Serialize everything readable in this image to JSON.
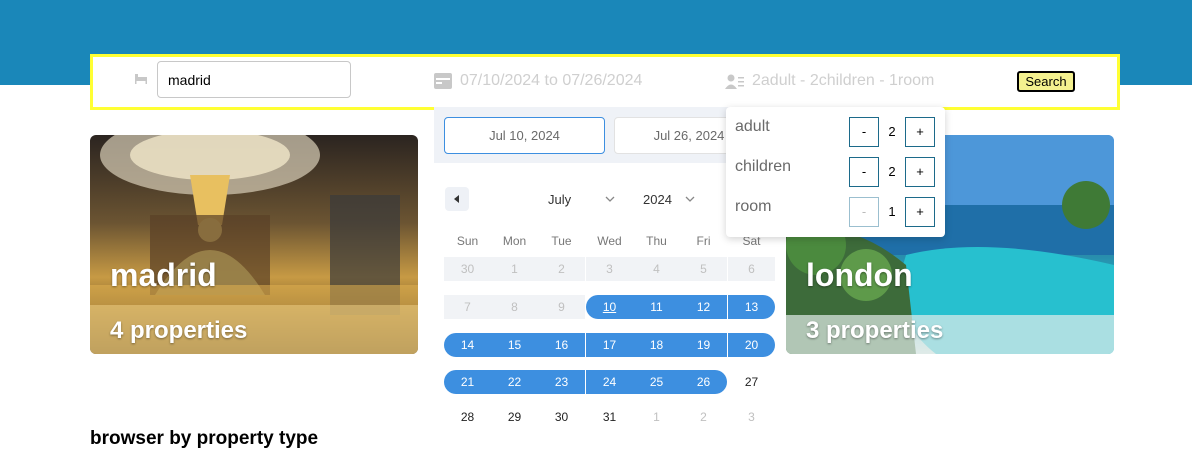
{
  "search": {
    "destination_value": "madrid",
    "date_range": "07/10/2024 to 07/26/2024",
    "guests_summary": "2adult - 2children - 1room",
    "search_label": "Search"
  },
  "cards": [
    {
      "name": "madrid",
      "properties": "4 properties"
    },
    {
      "name": "london",
      "properties": "3 properties"
    }
  ],
  "section_title": "browser by property type",
  "datepicker": {
    "start_label": "Jul 10, 2024",
    "end_label": "Jul 26, 2024",
    "month": "July",
    "year": "2024",
    "weekdays": [
      "Sun",
      "Mon",
      "Tue",
      "Wed",
      "Thu",
      "Fri",
      "Sat"
    ],
    "weeks": [
      [
        "30",
        "1",
        "2",
        "3",
        "4",
        "5",
        "6"
      ],
      [
        "7",
        "8",
        "9",
        "10",
        "11",
        "12",
        "13"
      ],
      [
        "14",
        "15",
        "16",
        "17",
        "18",
        "19",
        "20"
      ],
      [
        "21",
        "22",
        "23",
        "24",
        "25",
        "26",
        "27"
      ],
      [
        "28",
        "29",
        "30",
        "31",
        "1",
        "2",
        "3"
      ]
    ],
    "range_start": "10",
    "range_end": "26",
    "accent_color": "#3d8fe0"
  },
  "guests": {
    "rows": [
      {
        "label": "adult",
        "value": "2",
        "minus": "-",
        "plus": "+"
      },
      {
        "label": "children",
        "value": "2",
        "minus": "-",
        "plus": "+"
      },
      {
        "label": "room",
        "value": "1",
        "minus": "-",
        "plus": "+"
      }
    ]
  },
  "icons": {
    "destination": "bed-icon",
    "dates": "calendar-icon",
    "guests": "person-icon"
  }
}
